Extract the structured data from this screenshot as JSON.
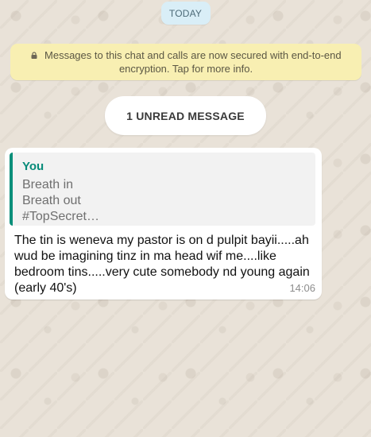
{
  "chat": {
    "date_label": "TODAY",
    "encryption_notice": "Messages to this chat and calls are now secured with end-to-end encryption. Tap for more info.",
    "unread_label": "1 UNREAD MESSAGE",
    "message": {
      "quoted_author": "You",
      "quoted_lines": [
        "Breath in",
        "Breath out",
        "#TopSecret…"
      ],
      "text": "The tin is weneva my pastor is on d pulpit bayii.....ah wud be imagining tinz in ma head wif me....like bedroom tins.....very cute somebody nd young again (early 40's)",
      "time": "14:06"
    }
  },
  "icons": {
    "lock": "lock-icon"
  },
  "colors": {
    "background": "#e9e2d8",
    "date_pill": "#d9eef7",
    "encryption_banner": "#f8efb2",
    "quote_accent": "#0b8f7a",
    "message_bubble": "#ffffff"
  }
}
